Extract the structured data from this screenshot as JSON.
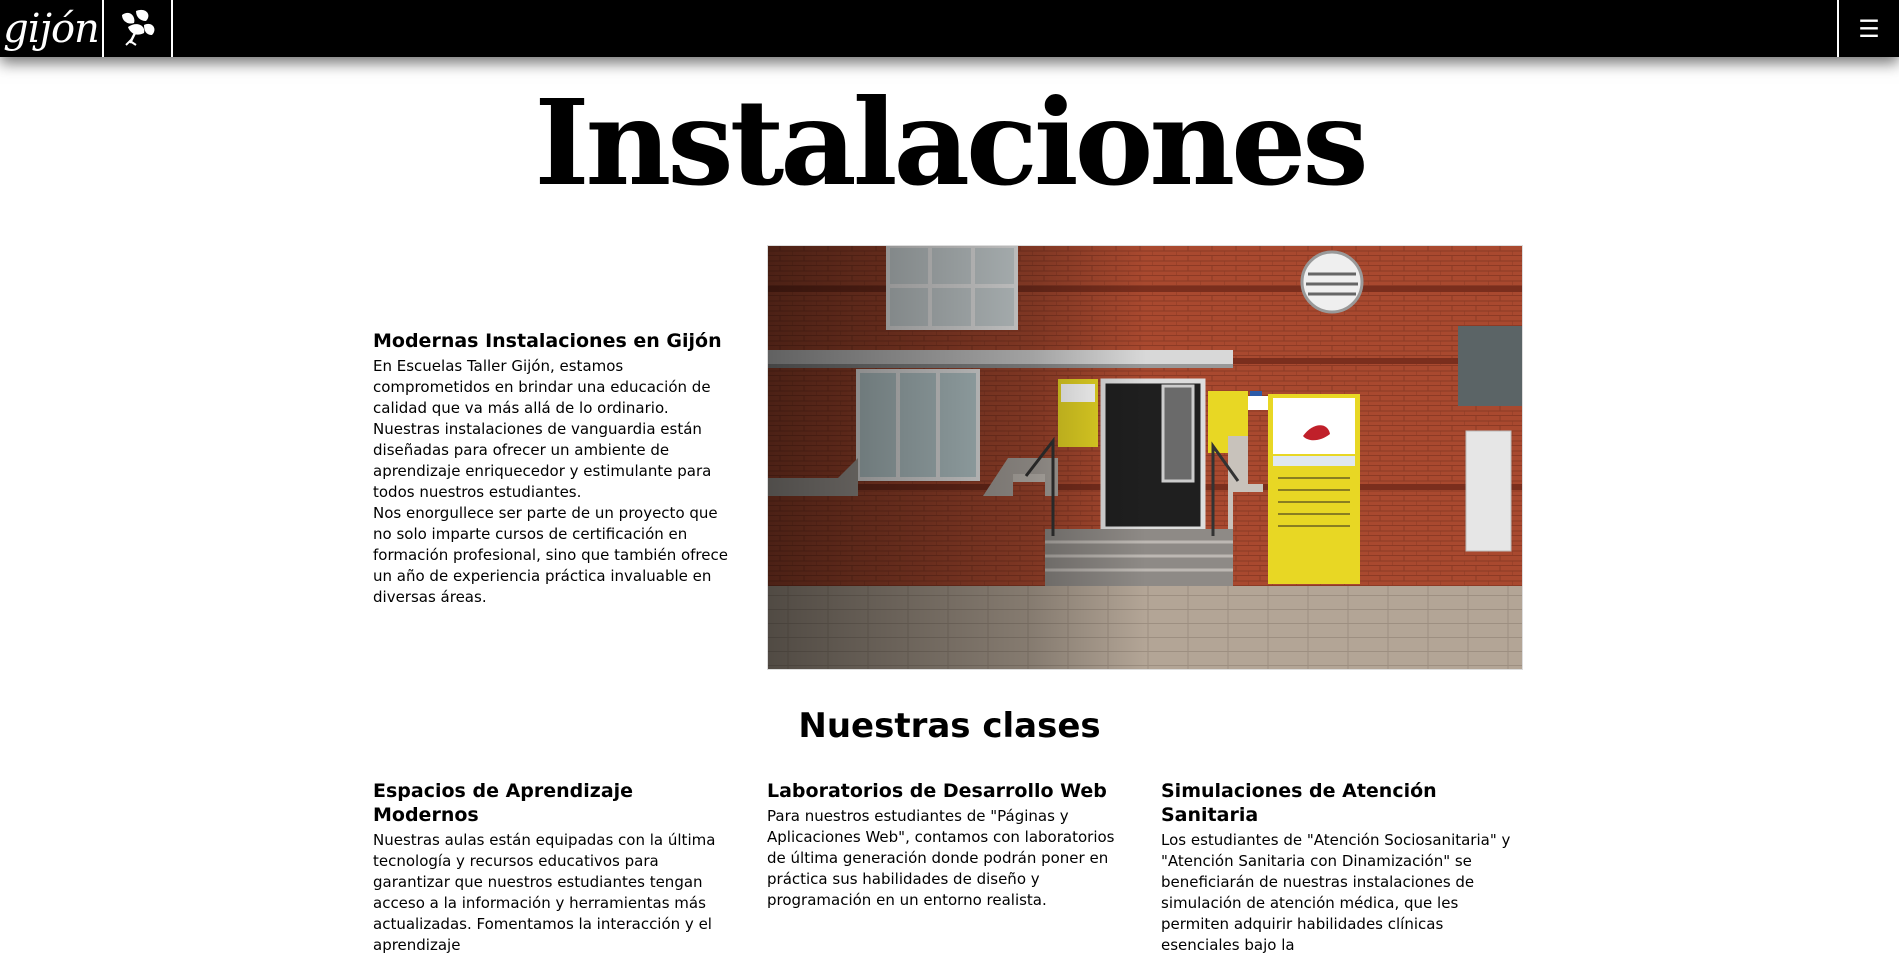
{
  "header": {
    "logo_text": "gijón",
    "logo_leaf_icon": "leaf-icon",
    "menu_icon": "☰"
  },
  "page": {
    "title": "Instalaciones"
  },
  "intro": {
    "heading": "Modernas Instalaciones en Gijón",
    "paragraphs": [
      "En Escuelas Taller Gijón, estamos comprometidos en brindar una educación de calidad que va más allá de lo ordinario.",
      "Nuestras instalaciones de vanguardia están diseñadas para ofrecer un ambiente de aprendizaje enriquecedor y estimulante para todos nuestros estudiantes.",
      "Nos enorgullece ser parte de un proyecto que no solo imparte cursos de certificación en formación profesional, sino que también ofrece un año de experiencia práctica invaluable en diversas áreas."
    ]
  },
  "classes": {
    "title": "Nuestras clases",
    "items": [
      {
        "heading": "Espacios de Aprendizaje Modernos",
        "text": "Nuestras aulas están equipadas con la última tecnología y recursos educativos para garantizar que nuestros estudiantes tengan acceso a la información y herramientas más actualizadas. Fomentamos la interacción y el aprendizaje"
      },
      {
        "heading": "Laboratorios de Desarrollo Web",
        "text": "Para nuestros estudiantes de \"Páginas y Aplicaciones Web\", contamos con laboratorios de última generación donde podrán poner en práctica sus habilidades de diseño y programación en un entorno realista."
      },
      {
        "heading": "Simulaciones de Atención Sanitaria",
        "text": "Los estudiantes de \"Atención Sociosanitaria\" y \"Atención Sanitaria con Dinamización\" se beneficiarán de nuestras instalaciones de simulación de atención médica, que les permiten adquirir habilidades clínicas esenciales bajo la"
      }
    ]
  },
  "colors": {
    "header_bg": "#000000",
    "brick": "#a3472e",
    "sign_yellow": "#e8d724"
  }
}
